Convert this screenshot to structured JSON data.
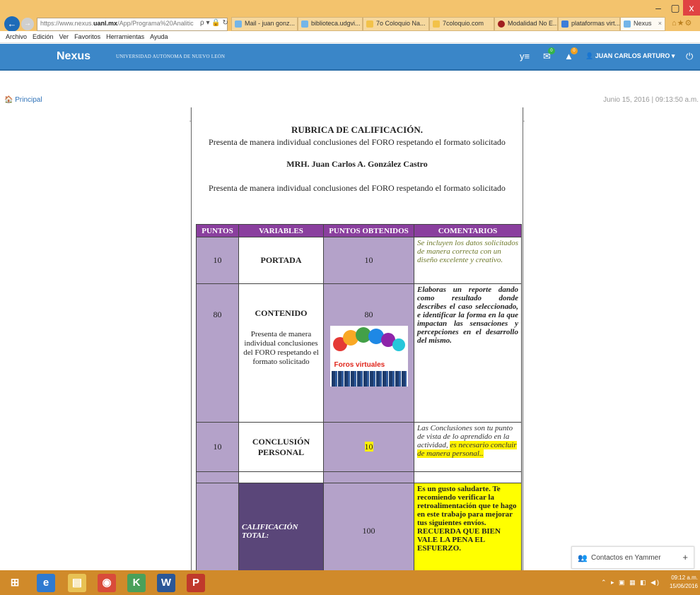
{
  "browser": {
    "window_controls": {
      "minimize": "–",
      "maximize": "▢",
      "close": "x"
    },
    "address": {
      "prefix": "https://www.nexus.",
      "domain": "uanl.mx",
      "path": "/App/Programa%20Analitic",
      "tools": "ρ ▾ 🔒 ↻"
    },
    "tabs": [
      {
        "label": "Mail - juan gonz...",
        "color": "#74b5e8"
      },
      {
        "label": "biblioteca.udgvi...",
        "color": "#74b5e8"
      },
      {
        "label": "7o Coloquio Na...",
        "color": "#f2c24a"
      },
      {
        "label": "7coloquio.com",
        "color": "#f2c24a"
      },
      {
        "label": "Modalidad No E...",
        "color": "#a11f1f"
      },
      {
        "label": "plataformas virt...",
        "color": "#3c7dd9"
      },
      {
        "label": "Nexus",
        "color": "#74b5e8",
        "active": true
      }
    ],
    "tab_close": "×",
    "right_icons": "⌂★⚙",
    "menu": [
      "Archivo",
      "Edición",
      "Ver",
      "Favoritos",
      "Herramientas",
      "Ayuda"
    ]
  },
  "app_header": {
    "brand": "Nexus",
    "university": "UNIVERSIDAD AUTÓNOMA DE NUEVO LEÓN",
    "yammer_glyph": "y≡",
    "mail_glyph": "✉",
    "mail_badge": "0",
    "alert_glyph": "▲",
    "alert_badge": "0",
    "user": "👤 JUAN CARLOS ARTURO ▾",
    "power_glyph": "⏻",
    "colors": {
      "bar": "#3a86c8",
      "mail_badge": "#34b34a",
      "alert_badge": "#f0a020"
    }
  },
  "breadcrumb": {
    "label": "🏠 Principal",
    "datetime": "Junio 15, 2016 | 09:13:50 a.m."
  },
  "document": {
    "title": "RUBRICA DE CALIFICACIÓN.",
    "subtitle": "Presenta de manera individual conclusiones del FORO respetando el formato solicitado",
    "author": "MRH. Juan Carlos A. González Castro",
    "subtitle2": "Presenta de manera individual conclusiones del FORO respetando el formato solicitado",
    "table": {
      "headers": [
        "PUNTOS",
        "VARIABLES",
        "PUNTOS OBTENIDOS",
        "COMENTARIOS"
      ],
      "rows": [
        {
          "puntos": "10",
          "variable": "PORTADA",
          "obtenidos": "10",
          "comentario": "Se incluyen los datos solicitados de manera correcta con un diseño excelente y creativo."
        },
        {
          "puntos": "80",
          "variable": "CONTENIDO",
          "variable_desc": "Presenta de manera individual conclusiones del FORO respetando el formato solicitado",
          "obtenidos": "80",
          "image_label": "Foros virtuales",
          "comentario": "Elaboras un reporte dando como resultado donde describes el caso seleccionado, e identificar la forma en la que impactan las sensaciones y percepciones en el desarrollo del mismo."
        },
        {
          "puntos": "10",
          "variable": "CONCLUSIÓN PERSONAL",
          "obtenidos": "10",
          "comentario_a": "Las Conclusiones son tu punto de vista de lo aprendido en la actividad,",
          "comentario_b": "es necesario concluir de manera personal.."
        }
      ],
      "total": {
        "label": "CALIFICACIÓN TOTAL:",
        "value": "100",
        "comentario": "Es un gusto saludarte. Te recomiendo verificar la retroalimentación que te hago en este trabajo para mejorar tus siguientes envíos. RECUERDA QUE BIEN VALE LA PENA EL ESFUERZO."
      }
    }
  },
  "yammer": {
    "icon": "👥",
    "label": "Contactos en Yammer",
    "plus": "+"
  },
  "taskbar": {
    "apps": [
      {
        "glyph": "⊞",
        "color": "#d08a2a"
      },
      {
        "glyph": "e",
        "color": "#2f7ad0"
      },
      {
        "glyph": "▤",
        "color": "#e8c255"
      },
      {
        "glyph": "◉",
        "color": "#d94b3a"
      },
      {
        "glyph": "K",
        "color": "#4aa05a"
      },
      {
        "glyph": "W",
        "color": "#2b5797"
      },
      {
        "glyph": "P",
        "color": "#c0392b"
      }
    ],
    "tray": "⌃ ▸ ▣ ▦ ◧ ◀)",
    "time": "09:12 a.m.",
    "date": "15/06/2016"
  }
}
